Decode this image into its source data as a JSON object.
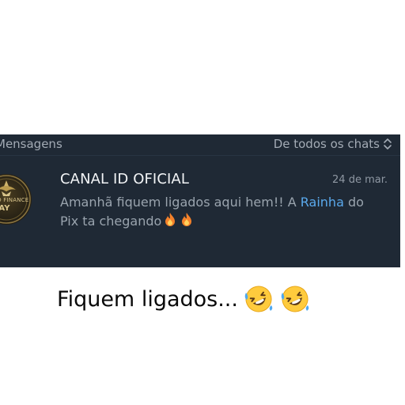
{
  "messages_panel": {
    "section_title": "Mensagens",
    "filter_label": "De todos os chats",
    "filter_icon": "chevron-up-down-icon"
  },
  "chat": {
    "name": "CANAL ID OFICIAL",
    "date": "24 de mar.",
    "preview_before": "Amanhã fiquem ligados aqui hem!! A ",
    "preview_highlight": "Rainha",
    "preview_after": " do Pix ta chegando",
    "preview_emojis": [
      "fire-emoji",
      "fire-emoji"
    ],
    "avatar_icon": "id-finance-pay-logo",
    "avatar_text_1": "ID FINANCE",
    "avatar_text_2": "PAY"
  },
  "caption": {
    "text": "Fiquem ligados...",
    "emojis": [
      "rolling-on-floor-laughing-emoji",
      "rolling-on-floor-laughing-emoji"
    ]
  },
  "colors": {
    "panel_bg": "#1f2935",
    "highlight": "#5aa9ec",
    "muted_text": "#9aa4ae",
    "title_text": "#f2f4f6"
  }
}
